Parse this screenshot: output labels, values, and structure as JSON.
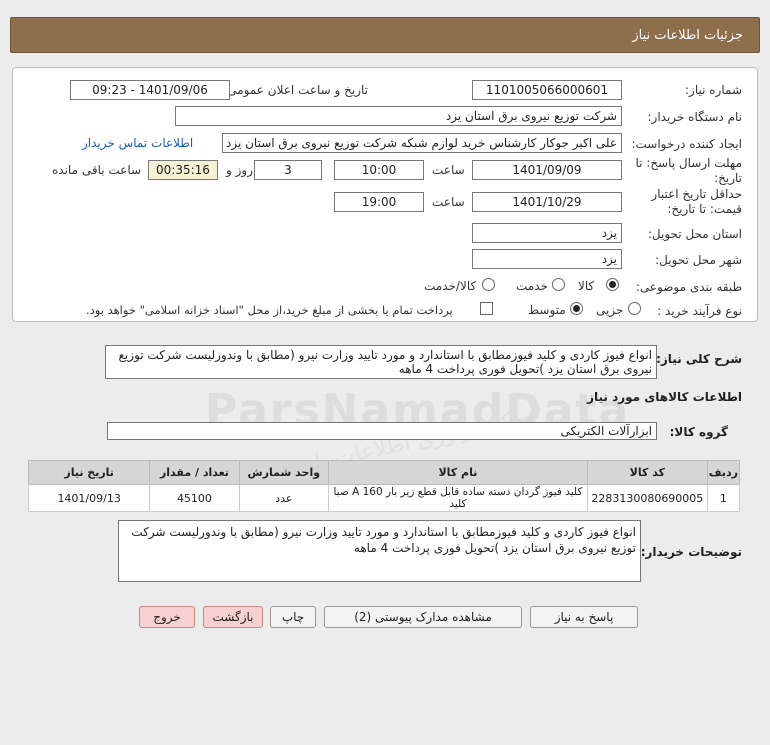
{
  "header": {
    "title": "جزئیات اطلاعات نیاز"
  },
  "form": {
    "need_number_label": "شماره نیاز:",
    "need_number": "1101005066000601",
    "announce_label": "تاریخ و ساعت اعلان عمومی:",
    "announce_value": "1401/09/06 - 09:23",
    "buyer_org_label": "نام دستگاه خریدار:",
    "buyer_org": "شرکت توزیع نیروی برق استان یزد",
    "creator_label": "ایجاد کننده درخواست:",
    "creator": "علی اکبر  جوکار  کارشناس خرید لوازم شبکه  شرکت توزیع نیروی برق استان یزد",
    "contact_link": "اطلاعات تماس خریدار",
    "deadline_label": "مهلت ارسال پاسخ: تا تاریخ:",
    "deadline_date": "1401/09/09",
    "time_label": "ساعت",
    "deadline_time": "10:00",
    "days_value": "3",
    "days_label": "روز و",
    "remaining_time": "00:35:16",
    "remaining_label": "ساعت باقی مانده",
    "validity_label": "حداقل تاریخ اعتبار قیمت: تا تاریخ:",
    "validity_date": "1401/10/29",
    "validity_time": "19:00",
    "province_label": "استان محل تحویل:",
    "province": "یزد",
    "city_label": "شهر محل تحویل:",
    "city": "یزد",
    "category_label": "طبقه بندی موضوعی:",
    "category_options": {
      "goods": "کالا",
      "service": "خدمت",
      "goods_service": "کالا/خدمت"
    },
    "process_label": "نوع فرآیند خرید :",
    "process_options": {
      "partial": "جزیی",
      "medium": "متوسط"
    },
    "payment_note": "پرداخت تمام یا بخشی از مبلغ خرید،از محل \"اسناد خزانه اسلامی\" خواهد بود."
  },
  "summary": {
    "label": "شرح کلی نیاز:",
    "text": "انواع فیوز کاردی و کلید فیوزمطابق با استاندارد و مورد تایید وزارت نیرو (مطابق با وندورلیست شرکت توزیع نیروی برق استان یزد )تحویل فوری پرداخت 4 ماهه"
  },
  "goods_info": {
    "title": "اطلاعات کالاهای مورد نیاز"
  },
  "goods_group": {
    "label": "گروه کالا:",
    "value": "ابزارآلات الکتریکی"
  },
  "table": {
    "headers": [
      "ردیف",
      "کد کالا",
      "نام کالا",
      "واحد شمارش",
      "تعداد / مقدار",
      "تاریخ نیاز"
    ],
    "rows": [
      [
        "1",
        "2283130080690005",
        "کلید فیوز گردان دسته ساده قابل قطع زیر بار 160 A صبا کلید",
        "عدد",
        "45100",
        "1401/09/13"
      ]
    ]
  },
  "buyer_notes": {
    "label": "توضیحات خریدار:",
    "text": "انواع فیوز کاردی و کلید فیوزمطابق با استاندارد و مورد تایید وزارت نیرو (مطابق با وندورلیست شرکت توزیع نیروی برق استان یزد )تحویل فوری پرداخت 4 ماهه"
  },
  "buttons": {
    "reply": "پاسخ به نیاز",
    "view_docs": "مشاهده مدارک پیوستی (2)",
    "print": "چاپ",
    "back": "بازگشت",
    "exit": "خروج"
  },
  "watermark": {
    "text": "ParsNamadData",
    "subtext": "مرکز فراوری اطلاعات پارس نماد داده"
  }
}
